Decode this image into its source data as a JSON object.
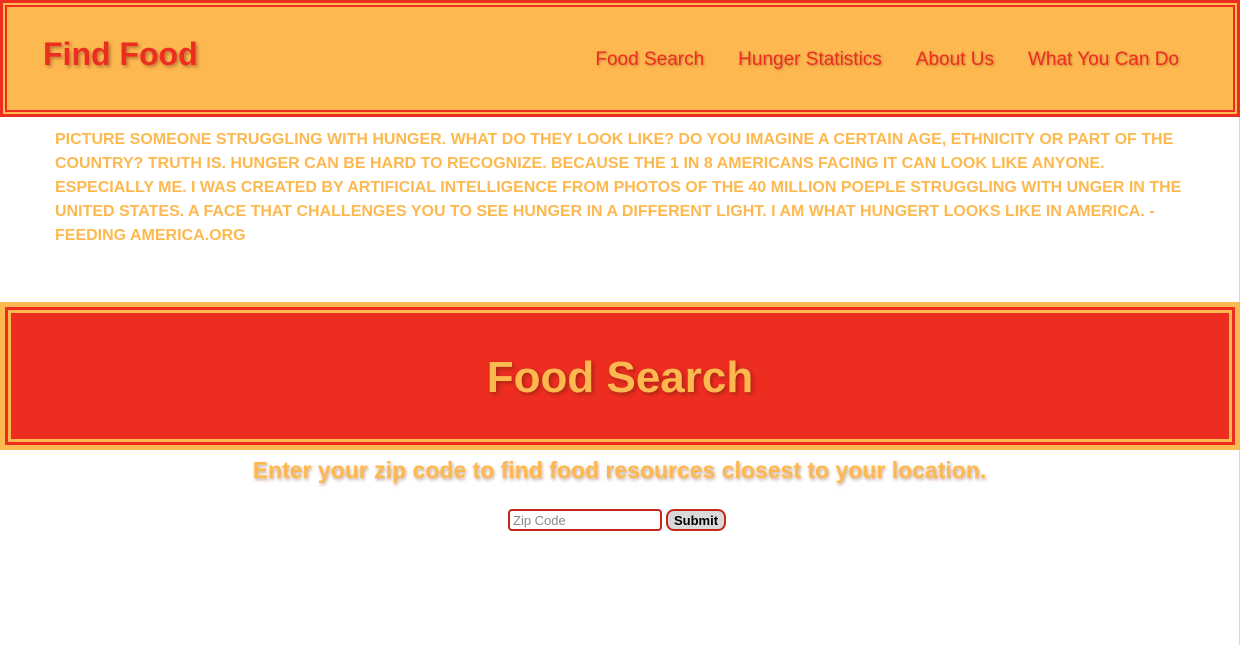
{
  "header": {
    "brand": "Find Food",
    "nav": [
      {
        "label": "Food Search"
      },
      {
        "label": "Hunger Statistics"
      },
      {
        "label": "About Us"
      },
      {
        "label": "What You Can Do"
      }
    ]
  },
  "quote": {
    "text": "Picture someone struggling with hunger. What do they look like? Do you imagine a certain age, ethnicity or part of the country? Truth is. Hunger can be hard to recognize. Because the 1 in 8 Americans facing it can look like anyone. Especially me. I was created by artificial intelligence from photos of the 40 million poeple struggling with unger in the United States. A face that challenges you to see hunger in a different light. I am what hungert looks like in America. - feeding america.org"
  },
  "food_search": {
    "title": "Food Search",
    "subtitle": "Enter your zip code to find food resources closest to your location.",
    "zip_placeholder": "Zip Code",
    "zip_value": "",
    "submit_label": "Submit"
  },
  "colors": {
    "accent_orange": "#fdb94f",
    "accent_red": "#ee2d21"
  }
}
